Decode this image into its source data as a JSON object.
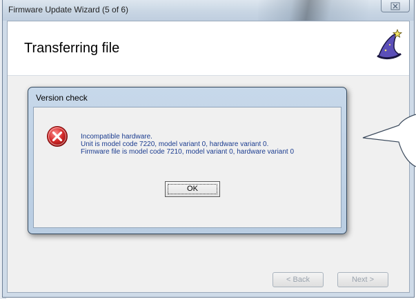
{
  "window": {
    "title": "Firmware Update Wizard (5 of 6)",
    "close_glyph": "⊠"
  },
  "header": {
    "heading": "Transferring file",
    "icon": "wizard-hat-icon"
  },
  "navigation": {
    "back_label": "< Back",
    "next_label": "Next >"
  },
  "dialog": {
    "title": "Version check",
    "icon": "error-icon",
    "message_lines": [
      "Incompatible hardware.",
      "Unit is model code 7220, model variant 0, hardware variant 0.",
      "Firmware file is model code 7210, model variant 0, hardware variant 0"
    ],
    "ok_label": "OK"
  },
  "colors": {
    "message_text": "#1b3c8f",
    "error_red": "#d42a2a",
    "dialog_frame": "#b9cde2"
  }
}
